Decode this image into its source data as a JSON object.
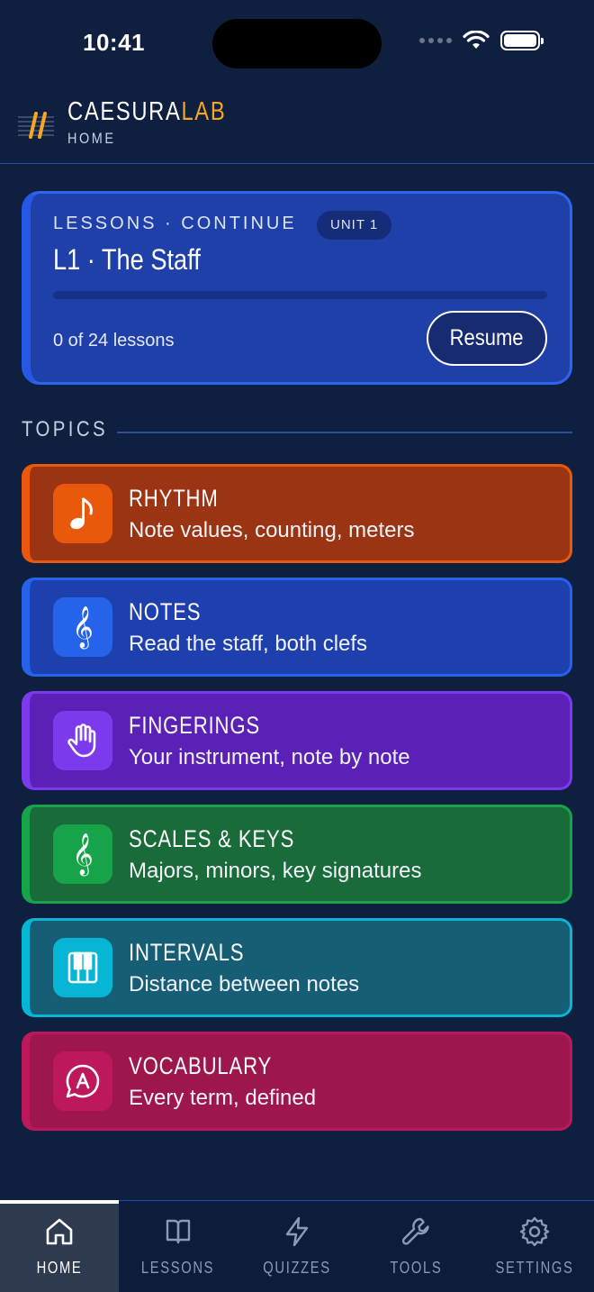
{
  "status_bar": {
    "time": "10:41"
  },
  "header": {
    "brand_main": "CAESURA",
    "brand_accent": "LAB",
    "subtitle": "HOME"
  },
  "continue_card": {
    "eyebrow": "LESSONS · CONTINUE",
    "unit_badge": "UNIT 1",
    "title": "L1 · The Staff",
    "progress_fraction": 0.0,
    "progress_text": "0 of 24 lessons",
    "resume_label": "Resume"
  },
  "topics": {
    "heading": "TOPICS",
    "items": [
      {
        "name": "RHYTHM",
        "desc": "Note values, counting, meters",
        "icon": "music-note-icon",
        "color": "#ea580c"
      },
      {
        "name": "NOTES",
        "desc": "Read the staff, both clefs",
        "icon": "treble-clef-icon",
        "color": "#2563eb"
      },
      {
        "name": "FINGERINGS",
        "desc": "Your instrument, note by note",
        "icon": "hand-icon",
        "color": "#7c3aed"
      },
      {
        "name": "SCALES & KEYS",
        "desc": "Majors, minors, key signatures",
        "icon": "treble-clef-icon",
        "color": "#16a34a"
      },
      {
        "name": "INTERVALS",
        "desc": "Distance between notes",
        "icon": "piano-keys-icon",
        "color": "#06b6d4"
      },
      {
        "name": "VOCABULARY",
        "desc": "Every term, defined",
        "icon": "speech-bubble-a-icon",
        "color": "#be185d"
      }
    ]
  },
  "bottom_nav": {
    "items": [
      {
        "label": "HOME",
        "icon": "home-icon",
        "active": true
      },
      {
        "label": "LESSONS",
        "icon": "book-icon",
        "active": false
      },
      {
        "label": "QUIZZES",
        "icon": "lightning-icon",
        "active": false
      },
      {
        "label": "TOOLS",
        "icon": "wrench-icon",
        "active": false
      },
      {
        "label": "SETTINGS",
        "icon": "gear-icon",
        "active": false
      }
    ]
  }
}
